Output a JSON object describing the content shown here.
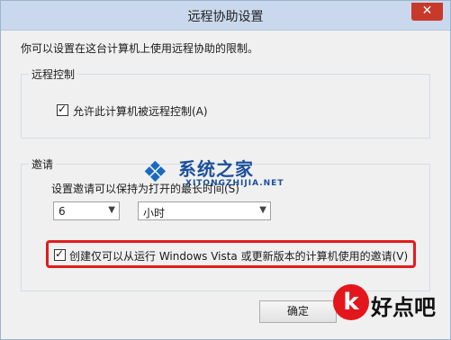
{
  "window": {
    "title": "远程协助设置",
    "close_glyph": "✕"
  },
  "description": "你可以设置在这台计算机上使用远程协助的限制。",
  "remote_control": {
    "group_title": "远程控制",
    "allow_label": "允许此计算机被远程控制(A)",
    "allow_checked": true
  },
  "invitation": {
    "group_title": "邀请",
    "max_time_label": "设置邀请可以保持为打开的最长时间(S)",
    "duration_value": "6",
    "unit_value": "小时",
    "vista_label": "创建仅可以从运行 Windows Vista 或更新版本的计算机使用的邀请(V)",
    "vista_checked": true
  },
  "buttons": {
    "ok": "确定"
  },
  "watermarks": {
    "site_brand": "系统之家",
    "site_url": "XITONGZHIJIA.NET",
    "corner_name": "好点吧",
    "corner_badge_glyph": "k"
  },
  "colors": {
    "highlight": "#e21c1c",
    "title_bar": "#c9d8ec",
    "close_button": "#c7392b",
    "watermark_blue": "#1b4f9c"
  }
}
